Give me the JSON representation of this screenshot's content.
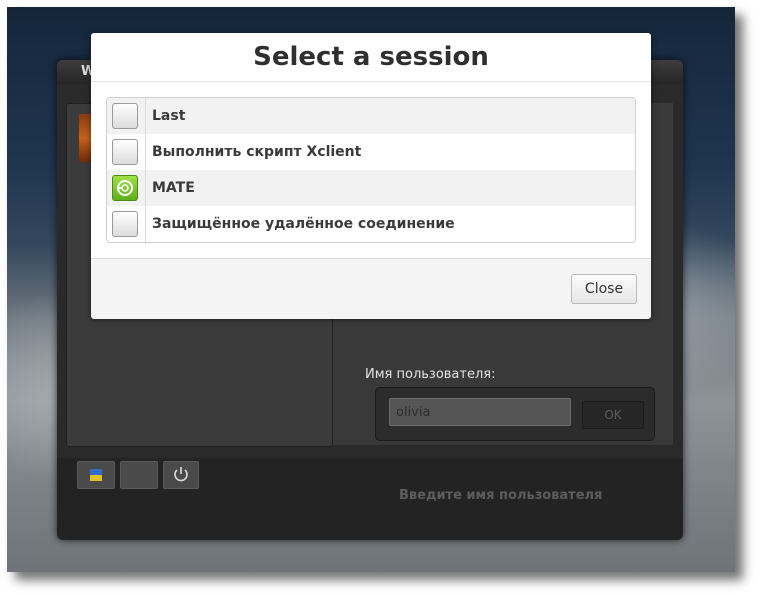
{
  "greeter": {
    "title": "W",
    "username_label": "Имя пользователя:",
    "username_value": "olivia",
    "ok_label": "OK",
    "hint": "Введите имя пользователя",
    "icons": [
      "keyboard-layout-icon",
      "session-icon",
      "power-icon"
    ]
  },
  "dialog": {
    "title": "Select a session",
    "sessions": [
      {
        "label": "Last",
        "checked": false
      },
      {
        "label": "Выполнить скрипт Xclient",
        "checked": false
      },
      {
        "label": "MATE",
        "checked": true
      },
      {
        "label": "Защищённое удалённое соединение",
        "checked": false
      }
    ],
    "close_label": "Close"
  },
  "colors": {
    "dialog_bg": "#ffffff",
    "checked_green": "#6fbd28",
    "greeter_panel": "#2a2a2a"
  }
}
